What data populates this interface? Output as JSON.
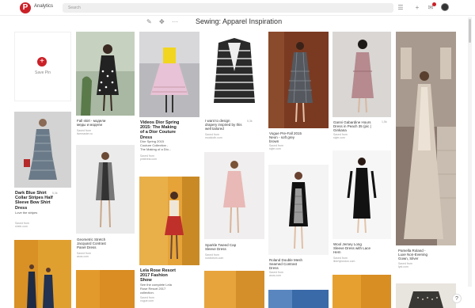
{
  "app": {
    "logo": "P",
    "title": "Analytics"
  },
  "search": {
    "placeholder": "Search"
  },
  "board": {
    "title": "Sewing: Apparel Inspiration"
  },
  "save_pin": {
    "label": "Save Pin"
  },
  "pins": {
    "p1": {
      "title": "Dark Blue Shirt\nCollar Stripes Half\nSleeve Bow Shirt\nDress",
      "desc": "Love the stripes",
      "src": "Saved from\nshein.com",
      "stat": "5,3k"
    },
    "p2": {
      "title": "Fall skirt - модели\nмеды и модели",
      "src": "Saved from\nlivemaster.ru"
    },
    "p3": {
      "title": "Geometric Stretch\nJacquard Contrast\nPanel Dress",
      "src": "Saved from\nasos.com"
    },
    "p4": {
      "title": "Videos Dior Spring\n2015: The Making\nof a Dior Couture\nDress",
      "desc": "Dior Spring 2015\nCouture Collection -\nThe Making of a Dio...",
      "src": "Saved from\npinterest.com"
    },
    "p5": {
      "title": "Lela Rose Resort\n2017 Fashion\nShow",
      "desc": "See the complete Lela\nRose Resort 2017\ncollection.",
      "src": "Saved from\nvogue.com"
    },
    "p6": {
      "title": "I want to design\ndrapery inspired by this\nwell tailored",
      "src": "Saved from\nmodcloth.com",
      "stat": "5,3k"
    },
    "p7": {
      "title": "Sparkle Tweed Cap\nSleeve Dress",
      "src": "Saved from\nnordstrom.com"
    },
    "p8": {
      "title": "Vogue Pre-Fall 2015\nNeon - soft grey\nbrown",
      "src": "Saved from\nstyle.com"
    },
    "p9": {
      "title": "Roland Double Mesh\nSeamed Contrast\nDress",
      "src": "Saved from\nasos.com"
    },
    "p10": {
      "title": "Ganni Gabardine Hours\nDress in Peach 35 (pic |\nGinkana",
      "src": "Saved from\nstyle.com",
      "stat": "1,5k"
    },
    "p11": {
      "title": "Wool Jersey Long\nSleeve Dress with Lace\nHem",
      "src": "Saved from\nlibertylondon.com"
    },
    "p12": {
      "title": "Pamella Roland -\nLuxe Non-Evening\nGown, Silver",
      "src": "Saved from\nlyst.com"
    }
  },
  "colors": {
    "accent": "#cb2027"
  },
  "icons": [
    "pinterest-logo-icon",
    "menu-icon",
    "plus-icon",
    "notifications-icon",
    "avatar",
    "edit-pencil-icon",
    "move-icon",
    "more-dots-icon",
    "help-icon"
  ]
}
